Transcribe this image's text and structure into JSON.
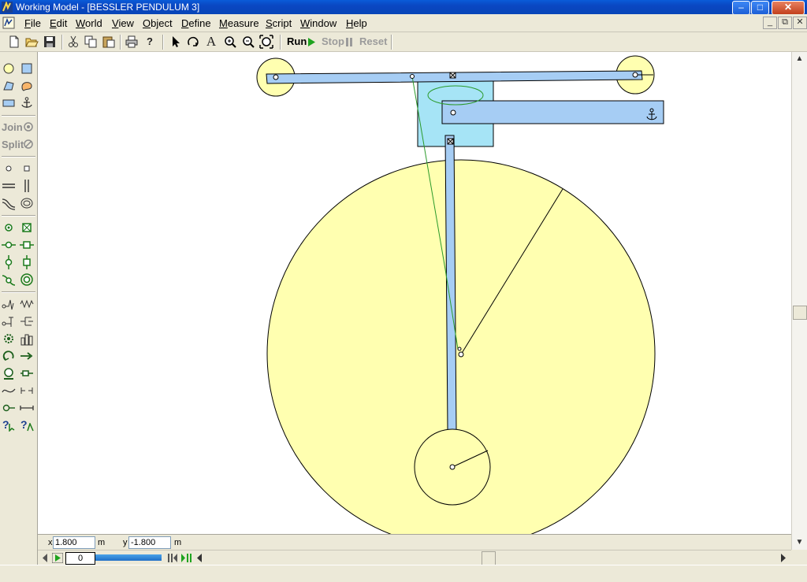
{
  "window": {
    "title": "Working Model - [BESSLER PENDULUM 3]",
    "controls": {
      "minimize": "–",
      "maximize": "□",
      "close": "✕"
    }
  },
  "menubar": {
    "items": [
      "File",
      "Edit",
      "World",
      "View",
      "Object",
      "Define",
      "Measure",
      "Script",
      "Window",
      "Help"
    ],
    "mdi_controls": {
      "minimize": "_",
      "restore": "⧉",
      "close": "✕"
    }
  },
  "toolbar": {
    "run_label": "Run",
    "stop_label": "Stop",
    "reset_label": "Reset",
    "text_tool_glyph": "A",
    "help_glyph": "?"
  },
  "palette": {
    "join_label": "Join",
    "split_label": "Split",
    "help_glyph_a": "?",
    "help_glyph_b": "?"
  },
  "coords": {
    "x_label": "x",
    "x_value": "1.800",
    "x_unit": "m",
    "y_label": "y",
    "y_value": "-1.800",
    "y_unit": "m"
  },
  "tape": {
    "frame": "0"
  },
  "colors": {
    "body_fill": "#ffffb0",
    "bar_fill": "#a6cdf4",
    "anchor_block_fill": "#a6e4f6",
    "spring_color": "#2a9a2a",
    "accent": "#0a47c2"
  },
  "icons": [
    "circle-tool-icon",
    "square-tool-icon",
    "polygon-tool-icon",
    "curved-body-icon",
    "rectangle-tool-icon",
    "anchor-tool-icon",
    "point-icon",
    "square-point-icon",
    "slot-horizontal-icon",
    "slot-vertical-icon",
    "curved-slot-icon",
    "closed-slot-icon",
    "pin-joint-icon",
    "rigid-joint-icon",
    "actuator-icon",
    "spring-icon",
    "damper-icon",
    "rope-icon",
    "gear-icon",
    "motor-icon",
    "force-icon",
    "torque-icon"
  ]
}
